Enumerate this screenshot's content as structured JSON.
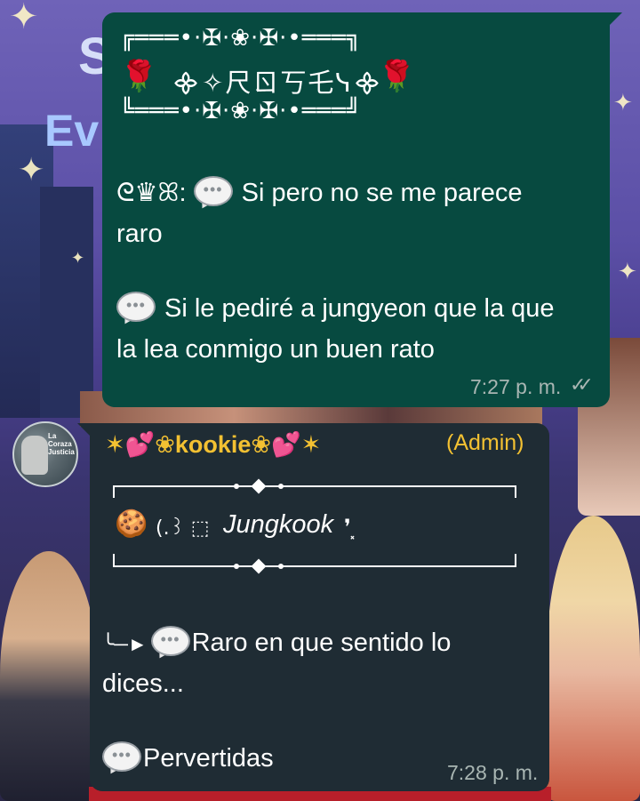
{
  "wallpaper": {
    "title_partial_1": "S",
    "title_partial_2": "Ev"
  },
  "messages": [
    {
      "direction": "outgoing",
      "header_top": "╔═══•·✠·❀·✠·•═══╗",
      "header_rose_left": "🌹",
      "header_title": "᯽✧尺ㄖ丂乇ᓭ᯽",
      "header_rose_right": "🌹",
      "header_bottom": "╚═══•·✠·❀·✠·•═══╝",
      "prefix": "ᘓ♛ꕤ:",
      "lines": [
        {
          "icon": "speech-balloon",
          "text": "Si pero no se me parece"
        },
        {
          "icon": "",
          "text": "raro"
        },
        {
          "icon": "speech-balloon",
          "text": "Si le pediré a jungyeon que la que"
        },
        {
          "icon": "",
          "text": "la lea conmigo un buen rato"
        }
      ],
      "time": "7:27 p. m.",
      "status": "read"
    },
    {
      "direction": "incoming",
      "sender": "✶💕❀kookie❀💕✶",
      "role": "(Admin)",
      "avatar_text": "La Coraza Justicia",
      "header_name_emoji": "🍪",
      "header_name": "Jungkook",
      "header_name_prefix": "(.꒱ ⬚",
      "header_name_suffix": "❜⸼",
      "arrow": "╰─►",
      "lines": [
        {
          "icon": "speech-balloon",
          "text": "Raro en que sentido lo"
        },
        {
          "icon": "",
          "text": "dices..."
        },
        {
          "icon": "speech-balloon",
          "text": "Pervertidas"
        }
      ],
      "time": "7:28 p. m."
    }
  ],
  "colors": {
    "outgoing_bubble": "#074a40",
    "incoming_bubble": "#1f2c34",
    "sender_name": "#f3c132",
    "meta": "#a9b6b3"
  }
}
